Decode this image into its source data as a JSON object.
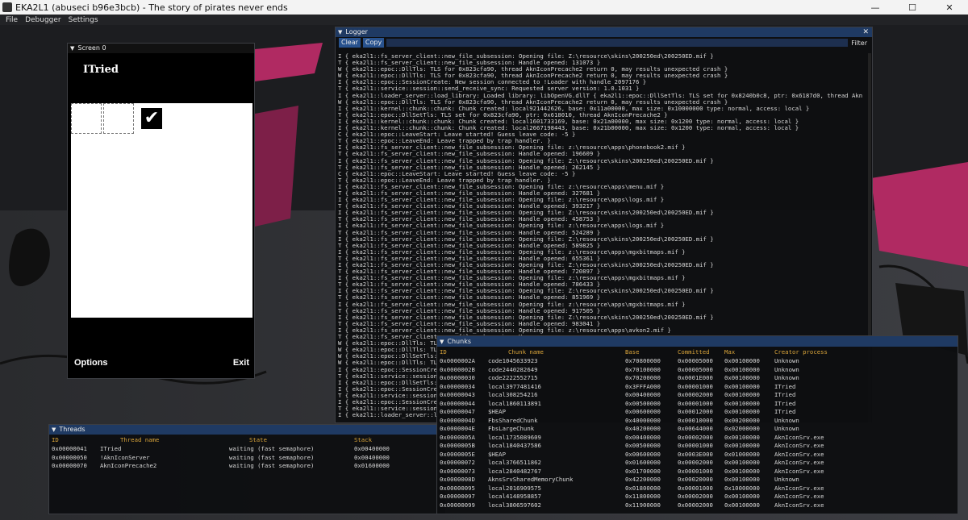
{
  "window": {
    "title": "EKA2L1 (abuseci b96e3bcb) - The story of pirates never ends",
    "minimize": "—",
    "maximize": "☐",
    "close": "✕"
  },
  "menu": [
    "File",
    "Debugger",
    "Settings"
  ],
  "screen": {
    "panel_title": "Screen 0",
    "heading": "ITried",
    "softkey_left": "Options",
    "softkey_right": "Exit",
    "check_glyph": "✔"
  },
  "logger": {
    "panel_title": "Logger",
    "clear": "Clear",
    "copy": "Copy",
    "filter": "Filter",
    "lines": [
      "I { eka2l1::fs_server_client::new_file_subsession: Opening file: Z:\\resource\\skins\\200250ed\\200250ED.mif }",
      "T { eka2l1::fs_server_client::new_file_subsession: Handle opened: 131073 }",
      "W { eka2l1::epoc::DllTls: TLS for 0x823cfa90, thread AknIconPrecache2 return 0, may results unexpected crash }",
      "W { eka2l1::epoc::DllTls: TLS for 0x823cfa90, thread AknIconPrecache2 return 0, may results unexpected crash }",
      "I { eka2l1::epoc::SessionCreate: New session connected to !Loader with handle 2097176 }",
      "T { eka2l1::service::session::send_receive_sync: Requested server version: 1.0.1031 }",
      "I { eka2l1::loader_server::load_library: Loaded library: libOpenVG.dllT { eka2l1::epoc::DllSetTls: TLS set for 0x8240b0c8, ptr: 0x6187d0, thread Akn",
      "W { eka2l1::epoc::DllTls: TLS for 0x823cfa90, thread AknIconPrecache2 return 0, may results unexpected crash }",
      "I { eka2l1::kernel::chunk::chunk: Chunk created: local921442626, base: 0x11a00000, max size: 0x10000000 type: normal, access: local }",
      "T { eka2l1::epoc::DllSetTls: TLS set for 0x823cfa90, ptr: 0x618010, thread AknIconPrecache2 }",
      "I { eka2l1::kernel::chunk::chunk: Chunk created: local1601733169, base: 0x21a00000, max size: 0x1200 type: normal, access: local }",
      "I { eka2l1::kernel::chunk::chunk: Chunk created: local2667198443, base: 0x21b00000, max size: 0x1200 type: normal, access: local }",
      "C { eka2l1::epoc::LeaveStart: Leave started! Guess leave code: -5 }",
      "T { eka2l1::epoc::LeaveEnd: Leave trapped by trap handler. }",
      "I { eka2l1::fs_server_client::new_file_subsession: Opening file: z:\\resource\\apps\\phonebook2.mif }",
      "T { eka2l1::fs_server_client::new_file_subsession: Handle opened: 196609 }",
      "I { eka2l1::fs_server_client::new_file_subsession: Opening file: Z:\\resource\\skins\\200250ed\\200250ED.mif }",
      "T { eka2l1::fs_server_client::new_file_subsession: Handle opened: 262145 }",
      "C { eka2l1::epoc::LeaveStart: Leave started! Guess leave code: -5 }",
      "T { eka2l1::epoc::LeaveEnd: Leave trapped by trap handler. }",
      "I { eka2l1::fs_server_client::new_file_subsession: Opening file: z:\\resource\\apps\\menu.mif }",
      "T { eka2l1::fs_server_client::new_file_subsession: Handle opened: 327681 }",
      "I { eka2l1::fs_server_client::new_file_subsession: Opening file: z:\\resource\\apps\\logs.mif }",
      "T { eka2l1::fs_server_client::new_file_subsession: Handle opened: 393217 }",
      "I { eka2l1::fs_server_client::new_file_subsession: Opening file: Z:\\resource\\skins\\200250ed\\200250ED.mif }",
      "T { eka2l1::fs_server_client::new_file_subsession: Handle opened: 458753 }",
      "I { eka2l1::fs_server_client::new_file_subsession: Opening file: z:\\resource\\apps\\logs.mif }",
      "T { eka2l1::fs_server_client::new_file_subsession: Handle opened: 524289 }",
      "I { eka2l1::fs_server_client::new_file_subsession: Opening file: Z:\\resource\\skins\\200250ed\\200250ED.mif }",
      "T { eka2l1::fs_server_client::new_file_subsession: Handle opened: 589825 }",
      "I { eka2l1::fs_server_client::new_file_subsession: Opening file: z:\\resource\\apps\\mgxbitmaps.mif }",
      "T { eka2l1::fs_server_client::new_file_subsession: Handle opened: 655361 }",
      "I { eka2l1::fs_server_client::new_file_subsession: Opening file: Z:\\resource\\skins\\200250ed\\200250ED.mif }",
      "T { eka2l1::fs_server_client::new_file_subsession: Handle opened: 720897 }",
      "I { eka2l1::fs_server_client::new_file_subsession: Opening file: z:\\resource\\apps\\mgxbitmaps.mif }",
      "T { eka2l1::fs_server_client::new_file_subsession: Handle opened: 786433 }",
      "I { eka2l1::fs_server_client::new_file_subsession: Opening file: Z:\\resource\\skins\\200250ed\\200250ED.mif }",
      "T { eka2l1::fs_server_client::new_file_subsession: Handle opened: 851969 }",
      "I { eka2l1::fs_server_client::new_file_subsession: Opening file: z:\\resource\\apps\\mgxbitmaps.mif }",
      "T { eka2l1::fs_server_client::new_file_subsession: Handle opened: 917505 }",
      "I { eka2l1::fs_server_client::new_file_subsession: Opening file: Z:\\resource\\skins\\200250ed\\200250ED.mif }",
      "T { eka2l1::fs_server_client::new_file_subsession: Handle opened: 983041 }",
      "I { eka2l1::fs_server_client::new_file_subsession: Opening file: z:\\resource\\apps\\avkon2.mif }",
      "T { eka2l1::fs_server_client::new_file_subsession: Ha",
      "W { eka2l1::epoc::DllTls: TL",
      "W { eka2l1::epoc::DllTls: TL",
      "W { eka2l1::epoc::DllSetTls: TL",
      "W { eka2l1::epoc::DllTls: TL",
      "I { eka2l1::epoc::SessionCre",
      "T { eka2l1::service::session",
      "I { eka2l1::epoc::DllSetTls:",
      "I { eka2l1::epoc::SessionCre",
      "T { eka2l1::service::session",
      "I { eka2l1::epoc::SessionCre",
      "T { eka2l1::service::session",
      "I { eka2l1::loader_server::l"
    ]
  },
  "threads": {
    "panel_title": "Threads",
    "columns": [
      "ID",
      "Thread name",
      "State",
      "Stack"
    ],
    "rows": [
      [
        "0x00000041",
        "ITried",
        "waiting (fast semaphore)",
        "0x00400000"
      ],
      [
        "0x00000050",
        "!AknIconServer",
        "waiting (fast semaphore)",
        "0x00400000"
      ],
      [
        "0x00000070",
        "AknIconPrecache2",
        "waiting (fast semaphore)",
        "0x01600000"
      ]
    ]
  },
  "chunks": {
    "panel_title": "Chunks",
    "columns": [
      "ID",
      "Chunk name",
      "Base",
      "Committed",
      "Max",
      "Creator process"
    ],
    "rows": [
      [
        "0x0000002A",
        "code1045633923",
        "0x70800000",
        "0x00005000",
        "0x00100000",
        "Unknown"
      ],
      [
        "0x0000002B",
        "code2440282649",
        "0x70100000",
        "0x00005000",
        "0x00100000",
        "Unknown"
      ],
      [
        "0x00000030",
        "code2222552715",
        "0x70200000",
        "0x0001E000",
        "0x00100000",
        "Unknown"
      ],
      [
        "0x00000034",
        "local3977481416",
        "0x3FFFA000",
        "0x00001000",
        "0x00100000",
        "ITried"
      ],
      [
        "0x00000043",
        "local308254216",
        "0x00400000",
        "0x00002000",
        "0x00100000",
        "ITried"
      ],
      [
        "0x00000044",
        "local1860113891",
        "0x00500000",
        "0x00001000",
        "0x00100000",
        "ITried"
      ],
      [
        "0x00000047",
        "$HEAP",
        "0x00600000",
        "0x00012000",
        "0x00100000",
        "ITried"
      ],
      [
        "0x0000004D",
        "FbsSharedChunk",
        "0x40000000",
        "0x00010000",
        "0x00200000",
        "Unknown"
      ],
      [
        "0x0000004E",
        "FbsLargeChunk",
        "0x40200000",
        "0x00644000",
        "0x02000000",
        "Unknown"
      ],
      [
        "0x0000005A",
        "local1735089609",
        "0x00400000",
        "0x00002000",
        "0x00100000",
        "AknIconSrv.exe"
      ],
      [
        "0x0000005B",
        "local1840437586",
        "0x00500000",
        "0x00001000",
        "0x00100000",
        "AknIconSrv.exe"
      ],
      [
        "0x0000005E",
        "$HEAP",
        "0x00600000",
        "0x0003E000",
        "0x01000000",
        "AknIconSrv.exe"
      ],
      [
        "0x00000072",
        "local3766511862",
        "0x01600000",
        "0x00002000",
        "0x00100000",
        "AknIconSrv.exe"
      ],
      [
        "0x00000073",
        "local2840482767",
        "0x01700000",
        "0x00001000",
        "0x00100000",
        "AknIconSrv.exe"
      ],
      [
        "0x0000008D",
        "AknsSrvSharedMemoryChunk",
        "0x42200000",
        "0x00020000",
        "0x00100000",
        "Unknown"
      ],
      [
        "0x00000095",
        "local2016909575",
        "0x01800000",
        "0x00001000",
        "0x10000000",
        "AknIconSrv.exe"
      ],
      [
        "0x00000097",
        "local4148958857",
        "0x11800000",
        "0x00002000",
        "0x00100000",
        "AknIconSrv.exe"
      ],
      [
        "0x00000099",
        "local3806597602",
        "0x11900000",
        "0x00002000",
        "0x00100000",
        "AknIconSrv.exe"
      ]
    ]
  }
}
